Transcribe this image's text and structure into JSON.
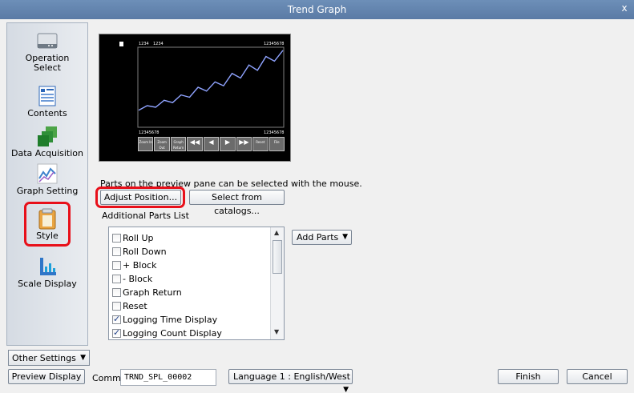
{
  "window": {
    "title": "Trend Graph",
    "close": "x"
  },
  "sidebar": {
    "items": [
      {
        "label1": "Operation",
        "label2": "Select",
        "icon": "drive-icon"
      },
      {
        "label1": "Contents",
        "label2": "",
        "icon": "contents-icon"
      },
      {
        "label1": "Data Acquisition",
        "label2": "",
        "icon": "data-acquisition-icon"
      },
      {
        "label1": "Graph Setting",
        "label2": "",
        "icon": "graph-setting-icon"
      },
      {
        "label1": "Style",
        "label2": "",
        "icon": "clipboard-icon"
      },
      {
        "label1": "Scale Display",
        "label2": "",
        "icon": "scale-display-icon"
      }
    ],
    "other_settings": "Other Settings"
  },
  "preview": {
    "top_left_1": "1234",
    "top_left_2": "1234",
    "top_right": "12345678",
    "bottom_left": "12345678",
    "bottom_right": "12345678",
    "buttons": [
      "Zoom In",
      "Zoom Out",
      "Graph Return",
      "◀◀",
      "◀",
      "▶",
      "▶▶",
      "Reset",
      "File"
    ],
    "chart_data": {
      "type": "line",
      "series": [
        {
          "values": [
            20,
            26,
            24,
            33,
            30,
            40,
            37,
            50,
            45,
            57,
            52,
            68,
            62,
            79,
            72,
            90,
            84,
            98
          ]
        }
      ]
    }
  },
  "main": {
    "hint": "Parts on the preview pane can be selected with the mouse.",
    "adjust_position": "Adjust Position...",
    "select_catalogs": "Select from catalogs...",
    "list_title": "Additional Parts List",
    "add_parts": "Add Parts",
    "parts": [
      {
        "label": "Roll Up",
        "checked": false
      },
      {
        "label": "Roll Down",
        "checked": false
      },
      {
        "label": "+ Block",
        "checked": false
      },
      {
        "label": "- Block",
        "checked": false
      },
      {
        "label": "Graph Return",
        "checked": false
      },
      {
        "label": "Reset",
        "checked": false
      },
      {
        "label": "Logging Time Display",
        "checked": true
      },
      {
        "label": "Logging Count Display",
        "checked": true
      }
    ]
  },
  "bottom": {
    "preview_display": "Preview Display",
    "comm_label": "Comm",
    "comm_value": "TRND_SPL_00002",
    "language": "Language 1 : English/West",
    "finish": "Finish",
    "cancel": "Cancel"
  }
}
